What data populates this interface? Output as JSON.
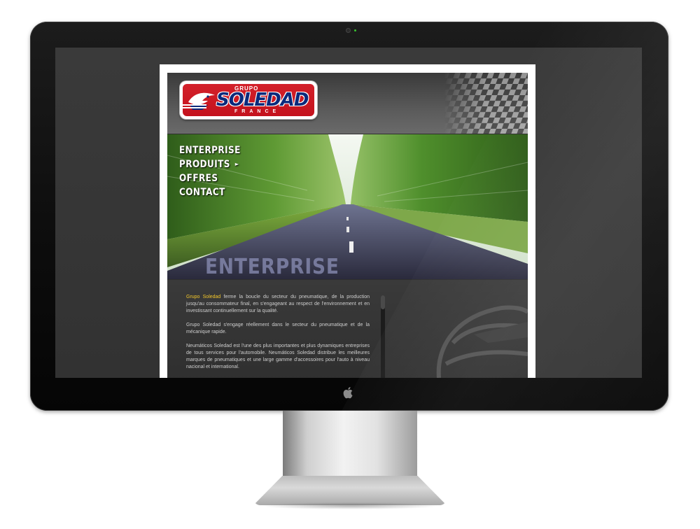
{
  "site": {
    "logo": {
      "top_text": "GRUPO",
      "word": "SOLEDAD",
      "sub_text": "FRANCE"
    },
    "nav": [
      {
        "label": "ENTERPRISE"
      },
      {
        "label": "PRODUITS"
      },
      {
        "label": "OFFRES"
      },
      {
        "label": "CONTACT"
      }
    ],
    "hero_watermark": "ENTERPRISE",
    "content": {
      "highlight": "Grupo Soledad",
      "p1_rest": " ferme la boucle du secteur du pneumatique, de la production jusqu'au consommateur final, en s'engageant au respect de l'environnement et en investissant continuellement sur la qualité.",
      "p2": "Grupo Soledad s'engage réellement dans le secteur du pneumatique et de la mécanique rapide.",
      "p3": "Neumáticos Soledad est l'une des plus importantes et plus dynamiques entreprises de tous services pour l'automobile. Neumáticos Soledad distribue les meilleures marques de pneumatiques et une large gamme d'accessoires pour l'auto à niveau nacional et international."
    }
  },
  "colors": {
    "accent": "#f2c62a",
    "logo_red": "#c4121d",
    "logo_blue": "#0b2a7c",
    "camera_led": "#38c22f"
  }
}
